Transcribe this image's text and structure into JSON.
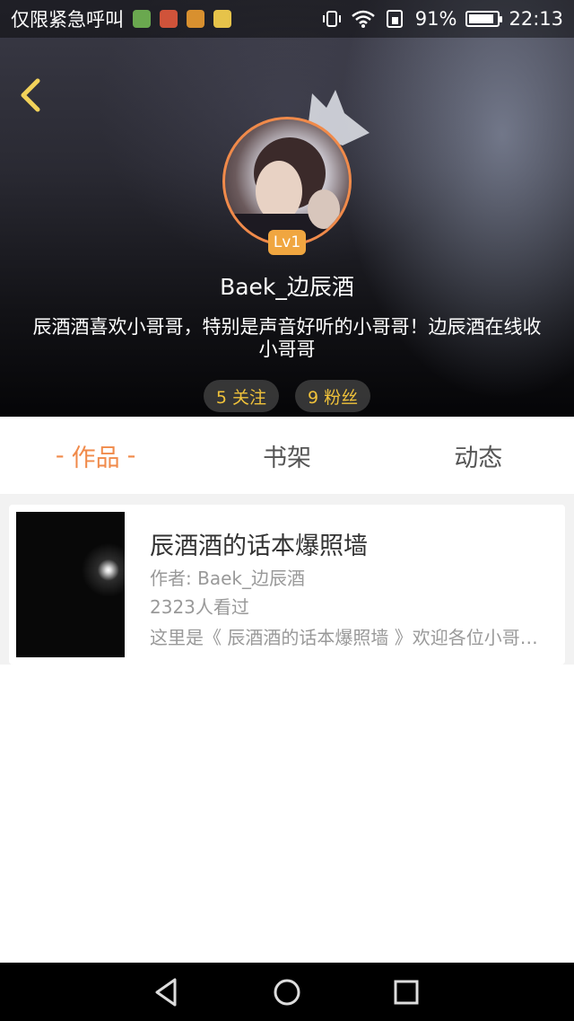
{
  "status_bar": {
    "carrier_text": "仅限紧急呼叫",
    "battery": "91%",
    "time": "22:13",
    "battery_level": 0.91
  },
  "profile": {
    "level": "Lv1",
    "username": "Baek_边辰酒",
    "bio": "辰酒酒喜欢小哥哥，特别是声音好听的小哥哥！边辰酒在线收小哥哥",
    "following": "5 关注",
    "followers": "9 粉丝"
  },
  "tabs": [
    {
      "label": "作品",
      "active": true,
      "dash": "-"
    },
    {
      "label": "书架",
      "active": false
    },
    {
      "label": "动态",
      "active": false
    }
  ],
  "works": [
    {
      "title": "辰酒酒的话本爆照墙",
      "author": "作者: Baek_边辰酒",
      "views": "2323人看过",
      "description": "这里是《 辰酒酒的话本爆照墙 》欢迎各位小哥…"
    }
  ],
  "colors": {
    "accent": "#f08a4a",
    "stat_text": "#f0c23a",
    "level_badge": "#f0a640"
  },
  "icons": {
    "back": "chevron-left-icon",
    "crown": "crown-icon",
    "nav_back": "triangle-back-icon",
    "nav_home": "circle-home-icon",
    "nav_recent": "square-recent-icon"
  }
}
